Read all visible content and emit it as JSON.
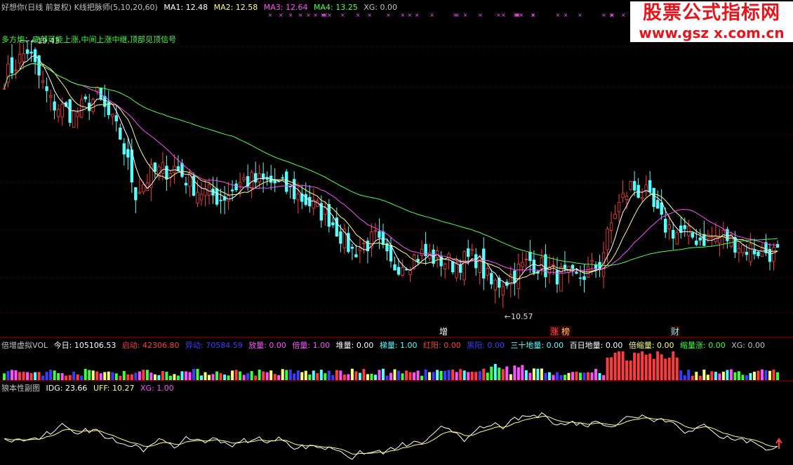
{
  "main_header": {
    "title": "好想你(日线 前复权) K线把脉师(5,10,20,60)",
    "ma1": "MA1: 12.48",
    "ma2": "MA2: 12.58",
    "ma3": "MA3: 12.64",
    "ma4": "MA4: 13.25",
    "xg": "XG: 0.00"
  },
  "signal_text": "多方炮：底部可能上涨,中间上涨中继,顶部见顶信号",
  "price_high_label": "19.43",
  "price_low_label": "10.57",
  "event_labels": [
    "增",
    "涨",
    "榜",
    "财"
  ],
  "vol_header": {
    "title": "倍增虚拟VOL",
    "today": "今日: 105106.53",
    "qidong": "启动: 42306.80",
    "yidong": "异动: 70584.59",
    "fangliang": "放量: 0.00",
    "beiliang": "倍量: 1.00",
    "duiliang": "堆量: 0.00",
    "tiliang": "梯量: 1.00",
    "hongyang": "红阳: 0.00",
    "heiyang": "黑阳: 0.00",
    "sanshidiliang": "三十地量: 0.00",
    "bairidiliang": "百日地量: 0.00",
    "beisuoliang": "倍缩量: 0.00",
    "suoliangzhang": "缩量涨: 0.00",
    "xg": "XG: 0.00"
  },
  "osc_header": {
    "title": "狼本性副图",
    "idg": "IDG: 23.66",
    "uff": "UFF: 10.27",
    "xg": "XG: 1.00"
  },
  "watermark": {
    "line1": "股票公式指标网",
    "line2": "www.gsz x.com.cn"
  },
  "colors": {
    "up": "#ff3c3c",
    "down": "#54ffff",
    "ma1": "#ffffff",
    "ma2": "#ffff80",
    "ma3": "#ff50ff",
    "ma4": "#50ff50",
    "grid": "#800000"
  },
  "chart_data": {
    "type": "candlestick",
    "price_ylim": [
      10.2,
      20.2
    ],
    "close_key_points": [
      [
        0,
        18.1
      ],
      [
        6,
        19.0
      ],
      [
        12,
        17.3
      ],
      [
        18,
        16.9
      ],
      [
        24,
        17.5
      ],
      [
        30,
        16.2
      ],
      [
        34,
        14.4
      ],
      [
        38,
        15.0
      ],
      [
        44,
        15.2
      ],
      [
        50,
        14.5
      ],
      [
        56,
        14.2
      ],
      [
        62,
        14.8
      ],
      [
        70,
        14.7
      ],
      [
        76,
        14.3
      ],
      [
        84,
        13.6
      ],
      [
        90,
        12.5
      ],
      [
        96,
        12.9
      ],
      [
        100,
        12.0
      ],
      [
        108,
        12.4
      ],
      [
        116,
        12.1
      ],
      [
        122,
        12.3
      ],
      [
        126,
        11.4
      ],
      [
        130,
        11.6
      ],
      [
        136,
        12.2
      ],
      [
        142,
        11.8
      ],
      [
        148,
        11.6
      ],
      [
        154,
        12.1
      ],
      [
        158,
        13.8
      ],
      [
        162,
        14.6
      ],
      [
        166,
        14.3
      ],
      [
        170,
        13.4
      ],
      [
        174,
        13.1
      ],
      [
        180,
        12.9
      ],
      [
        186,
        13.0
      ],
      [
        192,
        12.6
      ],
      [
        197,
        12.5
      ],
      [
        200,
        12.4
      ]
    ],
    "candle_count": 201,
    "ma_periods": [
      5,
      10,
      20,
      60
    ],
    "ma_last": {
      "MA1": 12.48,
      "MA2": 12.58,
      "MA3": 12.64,
      "MA4": 13.25
    },
    "volume_today": 105106.53,
    "osc": {
      "IDG_last": 23.66,
      "UFF_last": 10.27,
      "ylim": [
        0,
        100
      ]
    }
  }
}
